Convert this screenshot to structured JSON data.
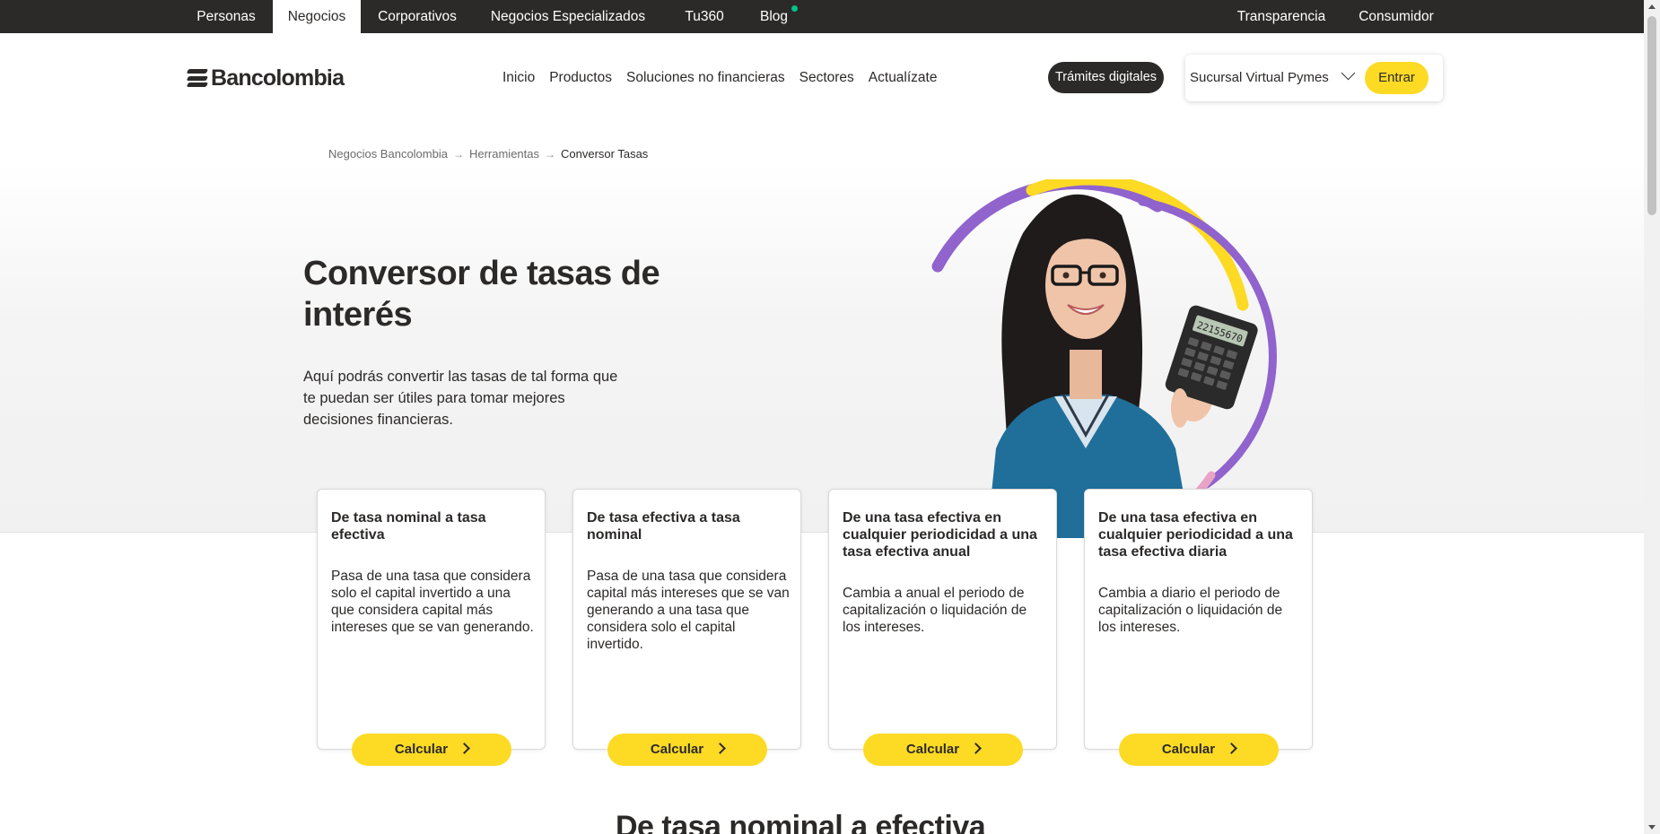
{
  "topbar": {
    "tabs": [
      {
        "label": "Personas"
      },
      {
        "label": "Negocios",
        "active": true
      },
      {
        "label": "Corporativos"
      },
      {
        "label": "Negocios Especializados",
        "has_dropdown": true
      },
      {
        "label": "Tu360"
      },
      {
        "label": "Blog",
        "has_dot": true
      }
    ],
    "right_links": [
      {
        "label": "Transparencia"
      },
      {
        "label": "Consumidor"
      }
    ]
  },
  "header": {
    "logo_text": "Bancolombia",
    "nav": [
      "Inicio",
      "Productos",
      "Soluciones no financieras",
      "Sectores",
      "Actualízate"
    ],
    "tramites_label": "Trámites digitales",
    "sucursal_select": "Sucursal Virtual Pymes",
    "entrar_label": "Entrar"
  },
  "breadcrumb": {
    "items": [
      "Negocios Bancolombia",
      "Herramientas"
    ],
    "current": "Conversor Tasas"
  },
  "hero": {
    "title": "Conversor de tasas de interés",
    "description": "Aquí podrás convertir las tasas de tal forma que te puedan ser útiles para tomar mejores decisiones financieras.",
    "calculator_display": "22155670"
  },
  "cards": [
    {
      "title": "De tasa nominal a tasa efectiva",
      "description": "Pasa de una tasa que considera solo el capital invertido a una que considera capital más intereses que se van generando.",
      "button": "Calcular"
    },
    {
      "title": "De tasa efectiva a tasa nominal",
      "description": "Pasa de una tasa que considera capital más intereses que se van generando a una tasa que considera solo el capital invertido.",
      "button": "Calcular"
    },
    {
      "title": "De una tasa efectiva en cualquier periodicidad a una tasa efectiva anual",
      "description": "Cambia a anual el periodo de capitalización o liquidación de los intereses.",
      "button": "Calcular"
    },
    {
      "title": "De una tasa efectiva en cualquier periodicidad a una tasa efectiva diaria",
      "description": "Cambia a diario el periodo de capitalización o liquidación de los intereses.",
      "button": "Calcular"
    }
  ],
  "section": {
    "title": "De tasa nominal a efectiva"
  },
  "colors": {
    "brand_yellow": "#fdda24",
    "dark": "#2c2a29",
    "accent_purple": "#9063cd",
    "accent_pink": "#e8a3c6",
    "blog_dot": "#00c389"
  }
}
